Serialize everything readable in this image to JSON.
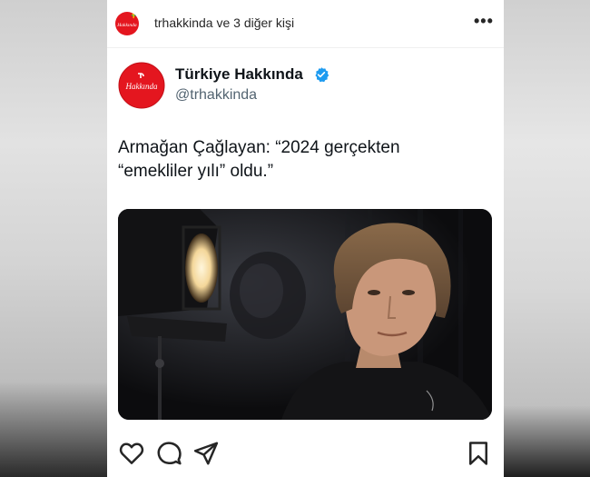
{
  "post_header": {
    "username_text": "trhakkinda ve 3 diğer kişi",
    "more_label": "•••",
    "avatar_logo_text": "Hakkında"
  },
  "tweet": {
    "display_name": "Türkiye Hakkında",
    "handle": "@trhakkinda",
    "avatar_logo_text": "Hakkında",
    "text_line_1": "Armağan Çağlayan: “2024 gerçekten",
    "text_line_2": "“emekliler yılı” oldu.”"
  },
  "icons": {
    "like": "heart-icon",
    "comment": "comment-icon",
    "share": "send-icon",
    "save": "bookmark-icon",
    "verified": "verified-badge-icon",
    "more": "more-icon"
  },
  "colors": {
    "brand_red": "#e4161f",
    "verified_blue": "#1d9bf0",
    "text_primary": "#0f1419",
    "text_secondary": "#536471"
  }
}
